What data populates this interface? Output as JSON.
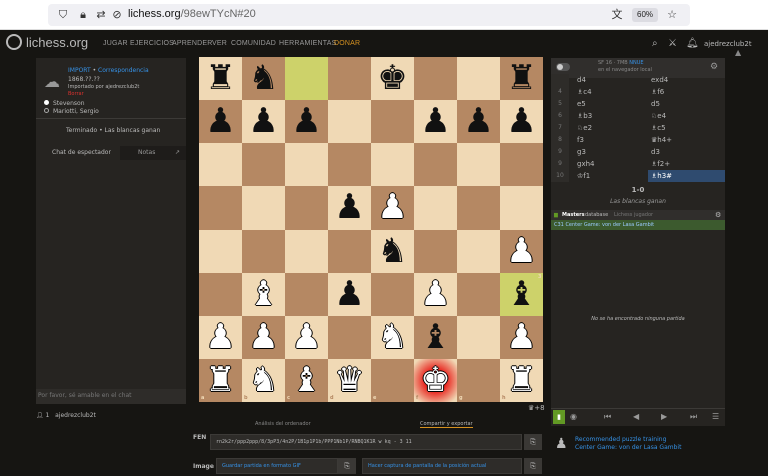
{
  "browser": {
    "host": "lichess.org",
    "path": "/98ewTYcN#20",
    "zoom": "60%"
  },
  "site": {
    "logo": "lichess.org",
    "nav": [
      "JUGAR",
      "EJERCICIOS",
      "APRENDER",
      "VER",
      "COMUNIDAD",
      "HERRAMIENTAS",
      "DONAR"
    ],
    "username": "ajedrezclub2t"
  },
  "game_info": {
    "type": "IMPORT",
    "mode": "Correspondencia",
    "date": "1868.??.??",
    "imported_by": "Importado por ajedrezclub2t",
    "status_tag": "Borrar",
    "white_player": "Stevenson",
    "black_player": "Mariotti, Sergio",
    "result": "Terminado • Las blancas ganan"
  },
  "chat": {
    "tab_chat": "Chat de espectador",
    "tab_notes": "Notas",
    "placeholder": "Por favor, sé amable en el chat"
  },
  "watchers": {
    "count": "1",
    "name": "ajedrezclub2t"
  },
  "board": {
    "files": [
      "a",
      "b",
      "c",
      "d",
      "e",
      "f",
      "g",
      "h"
    ],
    "ranks": [
      "8",
      "7",
      "6",
      "5",
      "4",
      "3",
      "2",
      "1"
    ],
    "pieces": [
      {
        "sq": "a8",
        "p": "r"
      },
      {
        "sq": "b8",
        "p": "n"
      },
      {
        "sq": "e8",
        "p": "k"
      },
      {
        "sq": "h8",
        "p": "r"
      },
      {
        "sq": "a7",
        "p": "p"
      },
      {
        "sq": "b7",
        "p": "p"
      },
      {
        "sq": "c7",
        "p": "p"
      },
      {
        "sq": "f7",
        "p": "p"
      },
      {
        "sq": "g7",
        "p": "p"
      },
      {
        "sq": "h7",
        "p": "p"
      },
      {
        "sq": "d5",
        "p": "p"
      },
      {
        "sq": "e5",
        "p": "P"
      },
      {
        "sq": "e4",
        "p": "n"
      },
      {
        "sq": "h4",
        "p": "P"
      },
      {
        "sq": "b3",
        "p": "B"
      },
      {
        "sq": "d3",
        "p": "p"
      },
      {
        "sq": "f3",
        "p": "P"
      },
      {
        "sq": "h3",
        "p": "b"
      },
      {
        "sq": "a2",
        "p": "P"
      },
      {
        "sq": "b2",
        "p": "P"
      },
      {
        "sq": "c2",
        "p": "P"
      },
      {
        "sq": "e2",
        "p": "N"
      },
      {
        "sq": "f2",
        "p": "b"
      },
      {
        "sq": "h2",
        "p": "P"
      },
      {
        "sq": "a1",
        "p": "R"
      },
      {
        "sq": "b1",
        "p": "N"
      },
      {
        "sq": "c1",
        "p": "B"
      },
      {
        "sq": "d1",
        "p": "Q"
      },
      {
        "sq": "f1",
        "p": "K"
      },
      {
        "sq": "h1",
        "p": "R"
      }
    ],
    "highlight": [
      "c8",
      "h3"
    ],
    "check": "f1",
    "material": "♛+8"
  },
  "subtabs": {
    "analysis": "Análisis del ordenador",
    "share": "Compartir y exportar"
  },
  "fen": {
    "label": "FEN",
    "value": "rn2k2r/ppp2ppp/8/3pP3/4n2P/1B1p1P1b/PPP1Nb1P/RNBQ1K1R w kq - 3 11"
  },
  "image": {
    "label": "Image",
    "gif": "Guardar partida en formato GIF",
    "screenshot": "Hacer captura de pantalla de la posición actual"
  },
  "engine": {
    "name": "SF 16 · 7MB",
    "nnue": "NNUE",
    "location": "en el navegador local"
  },
  "moves": [
    {
      "n": "",
      "w": "d4",
      "b": "exd4"
    },
    {
      "n": "4",
      "w": "♗c4",
      "b": "♗f6"
    },
    {
      "n": "5",
      "w": "e5",
      "b": "d5"
    },
    {
      "n": "6",
      "w": "♗b3",
      "b": "♘e4"
    },
    {
      "n": "7",
      "w": "♘e2",
      "b": "♗c5"
    },
    {
      "n": "8",
      "w": "f3",
      "b": "♛h4+"
    },
    {
      "n": "9",
      "w": "g3",
      "b": "d3"
    },
    {
      "n": "9",
      "w": "gxh4",
      "b": "♗f2+"
    },
    {
      "n": "10",
      "w": "♔f1",
      "b": "♗h3#"
    }
  ],
  "result": {
    "score": "1-0",
    "description": "Las blancas ganan"
  },
  "explorer": {
    "masters": "Masters",
    "database": "database",
    "lichess": "Lichess",
    "player": "jugador",
    "opening": "C31 Center Game: von der Lasa Gambit",
    "no_games": "No se ha encontrado ninguna partida"
  },
  "puzzle": {
    "title": "Recommended puzzle training",
    "theme": "Center Game: von der Lasa Gambit"
  },
  "colors": {
    "light_square": "#f0d9b5",
    "dark_square": "#b58863",
    "accent": "#d59120",
    "link": "#3692e7"
  }
}
